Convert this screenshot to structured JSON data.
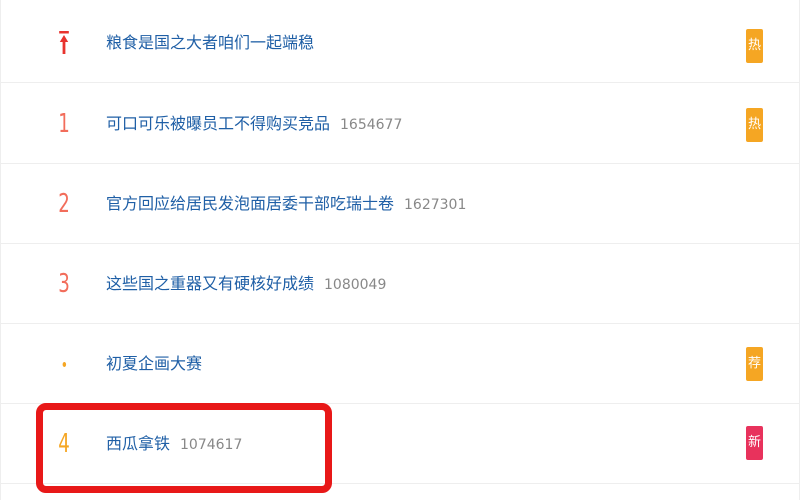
{
  "list": {
    "rows": [
      {
        "rank": "",
        "rank_icon": "pin-top-icon",
        "title": "粮食是国之大者咱们一起端稳",
        "count": "",
        "badge": "热",
        "badge_color": "#f5a623"
      },
      {
        "rank": "1",
        "title": "可口可乐被曝员工不得购买竞品",
        "count": "1654677",
        "badge": "热",
        "badge_color": "#f5a623"
      },
      {
        "rank": "2",
        "title": "官方回应给居民发泡面居委干部吃瑞士卷",
        "count": "1627301",
        "badge": "",
        "badge_color": ""
      },
      {
        "rank": "3",
        "title": "这些国之重器又有硬核好成绩",
        "count": "1080049",
        "badge": "",
        "badge_color": ""
      },
      {
        "rank": "",
        "rank_icon": "promo-dot-icon",
        "title": "初夏企画大赛",
        "count": "",
        "badge": "荐",
        "badge_color": "#f5a623"
      },
      {
        "rank": "4",
        "title": "西瓜拿铁",
        "count": "1074617",
        "badge": "新",
        "badge_color": "#e8325c"
      }
    ]
  },
  "annotation": {
    "color": "#e81818"
  }
}
